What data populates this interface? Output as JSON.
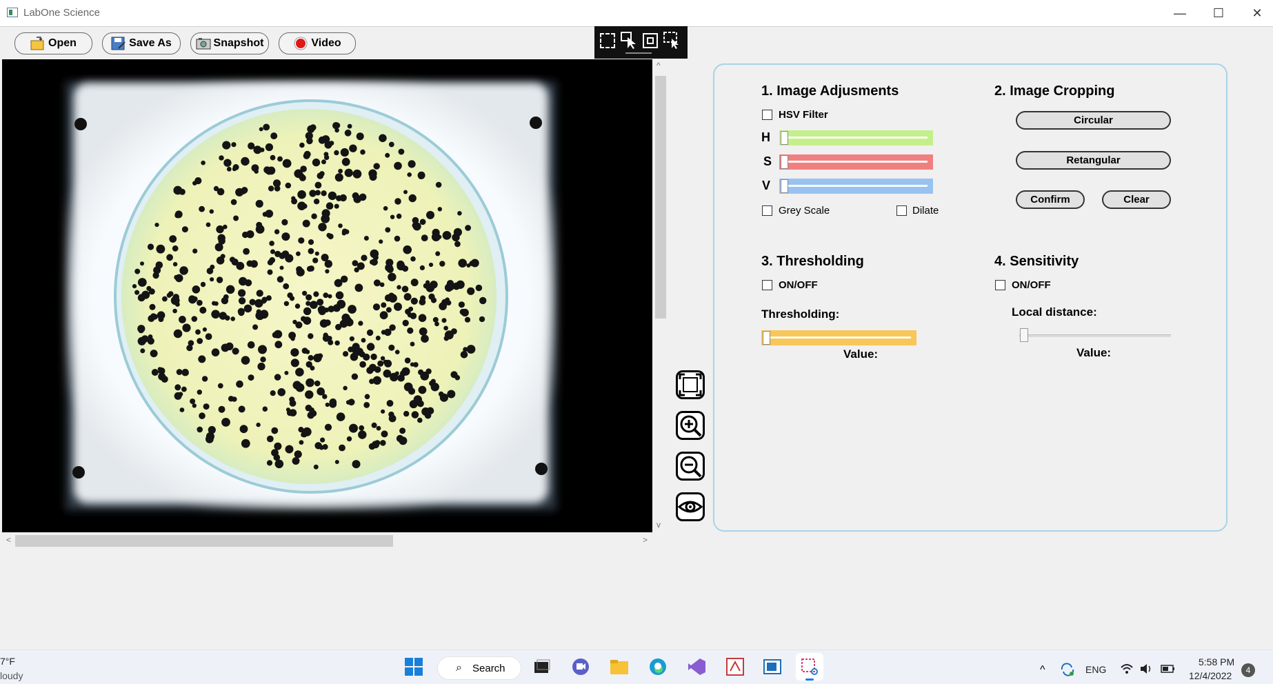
{
  "window": {
    "title": "LabOne Science",
    "minimize": "—",
    "maximize": "☐",
    "close": "✕"
  },
  "toolbar": {
    "open_label": "Open",
    "save_as_label": "Save As",
    "snapshot_label": "Snapshot",
    "video_label": "Video"
  },
  "panel": {
    "adjust": {
      "title": "1. Image Adjusments",
      "hsv_label": "HSV Filter",
      "h_label": "H",
      "s_label": "S",
      "v_label": "V",
      "grey_label": "Grey Scale",
      "dilate_label": "Dilate",
      "colors": {
        "h": "#c4f08c",
        "s": "#f08080",
        "v": "#99c2f0"
      }
    },
    "cropping": {
      "title": "2. Image Cropping",
      "circular_label": "Circular",
      "rect_label": "Retangular",
      "confirm_label": "Confirm",
      "clear_label": "Clear"
    },
    "threshold": {
      "title": "3. Thresholding",
      "onoff_label": "ON/OFF",
      "slider_label": "Thresholding:",
      "value_label": "Value:",
      "color": "#f8c75a"
    },
    "sensitivity": {
      "title": "4. Sensitivity",
      "onoff_label": "ON/OFF",
      "slider_label": "Local distance:",
      "value_label": "Value:"
    }
  },
  "taskbar": {
    "weather_temp": "7°F",
    "weather_desc": "loudy",
    "search_label": "Search",
    "lang": "ENG",
    "time": "5:58 PM",
    "date": "12/4/2022",
    "notif_count": "4"
  }
}
